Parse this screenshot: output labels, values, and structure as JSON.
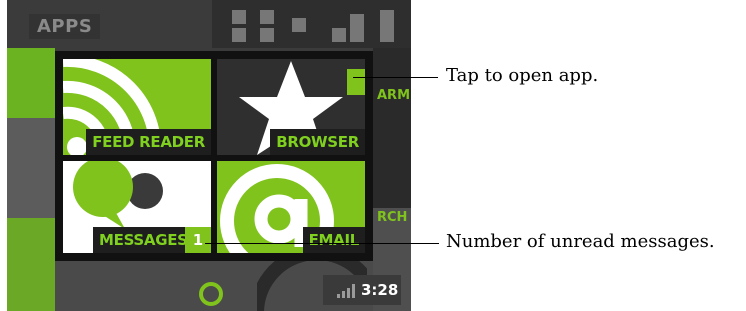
{
  "screen": {
    "apps_label": "APPS",
    "side_labels": {
      "alarm": "ARM",
      "search": "RCH"
    },
    "tiles": {
      "feed_reader": "FEED READER",
      "browser": "BROWSER",
      "messages": "MESSAGES",
      "email": "EMAIL"
    },
    "unread_count": "1",
    "clock": "3:28",
    "icons": [
      "rss-icon",
      "star-icon",
      "speech-bubble-icon",
      "at-sign-icon",
      "signal-icon",
      "home-ring-icon"
    ]
  },
  "callouts": {
    "tap": "Tap to open app.",
    "unread": "Number of unread messages."
  },
  "colors": {
    "accent": "#7fc31c",
    "tile_dark": "#1e1e1e"
  }
}
